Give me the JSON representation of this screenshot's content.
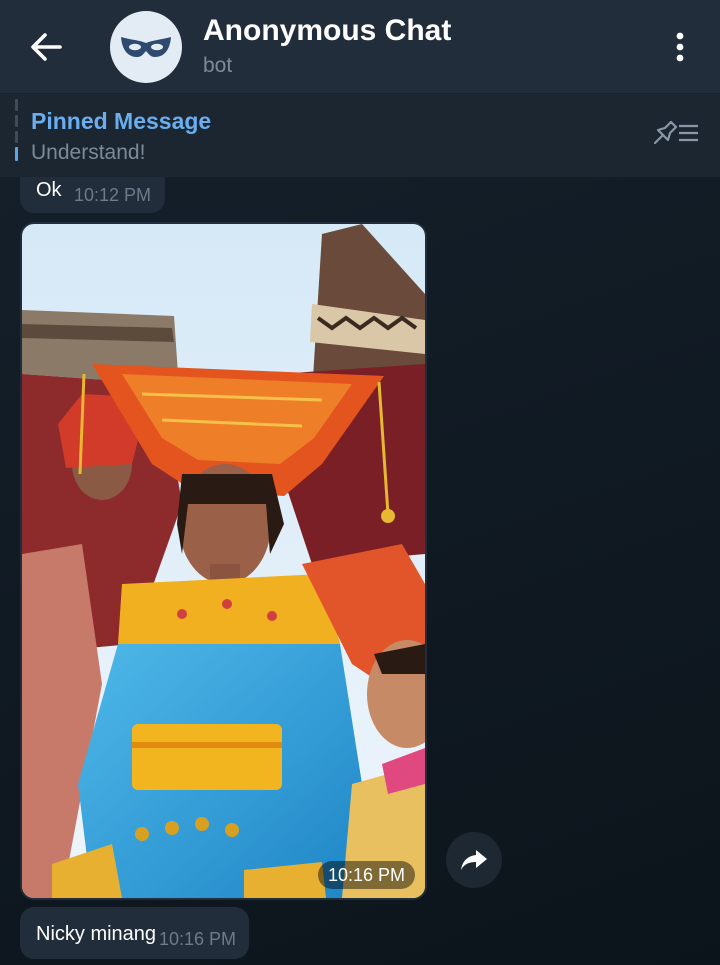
{
  "header": {
    "title": "Anonymous Chat",
    "subtitle": "bot",
    "back_icon": "arrow-left-icon",
    "avatar_icon": "mask-icon",
    "menu_icon": "more-vertical-icon"
  },
  "pinned": {
    "title": "Pinned Message",
    "text": "Understand!",
    "list_icon": "pinned-list-icon"
  },
  "messages": [
    {
      "type": "text",
      "text": "Ok",
      "time": "10:12 PM"
    },
    {
      "type": "photo",
      "time": "10:16 PM",
      "share_icon": "share-arrow-icon"
    },
    {
      "type": "text",
      "text": "Nicky minang",
      "time": "10:16 PM"
    }
  ],
  "colors": {
    "header_bg": "#212d3b",
    "bubble_bg": "#212d3b",
    "accent": "#6aaef0",
    "chat_bg": "#111b24"
  }
}
